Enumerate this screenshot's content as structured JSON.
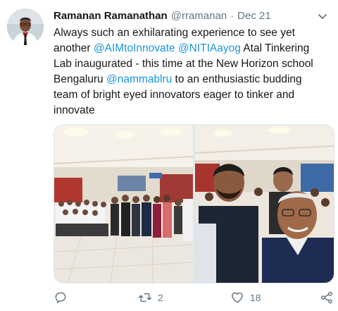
{
  "tweet": {
    "author": {
      "display_name": "Ramanan Ramanathan",
      "handle": "@rramanan",
      "separator": "·",
      "date": "Dec 21"
    },
    "text": {
      "line1": "Always such an exhilarating experience to see yet",
      "line2_prefix": "another ",
      "line2_mention1": "@AIMtoInnovate",
      "line2_space": " ",
      "line2_mention2": "@NITIAayog",
      "line2_suffix": " Atal Tinkering",
      "line3": "Lab inaugurated - this time at the New Horizon school",
      "line4_prefix": "Bengaluru ",
      "line4_mention": "@nammablru",
      "line4_suffix": " to an enthusiastic budding",
      "line5": "team of bright eyed innovators eager to tinker and",
      "line6": "innovate"
    },
    "actions": {
      "reply_icon": "reply-icon",
      "retweet_icon": "retweet-icon",
      "retweet_count": "2",
      "like_icon": "heart-icon",
      "like_count": "18",
      "share_icon": "share-icon"
    },
    "colors": {
      "link": "#1b95e0",
      "secondary_text": "#657786",
      "primary_text": "#14171a"
    }
  }
}
